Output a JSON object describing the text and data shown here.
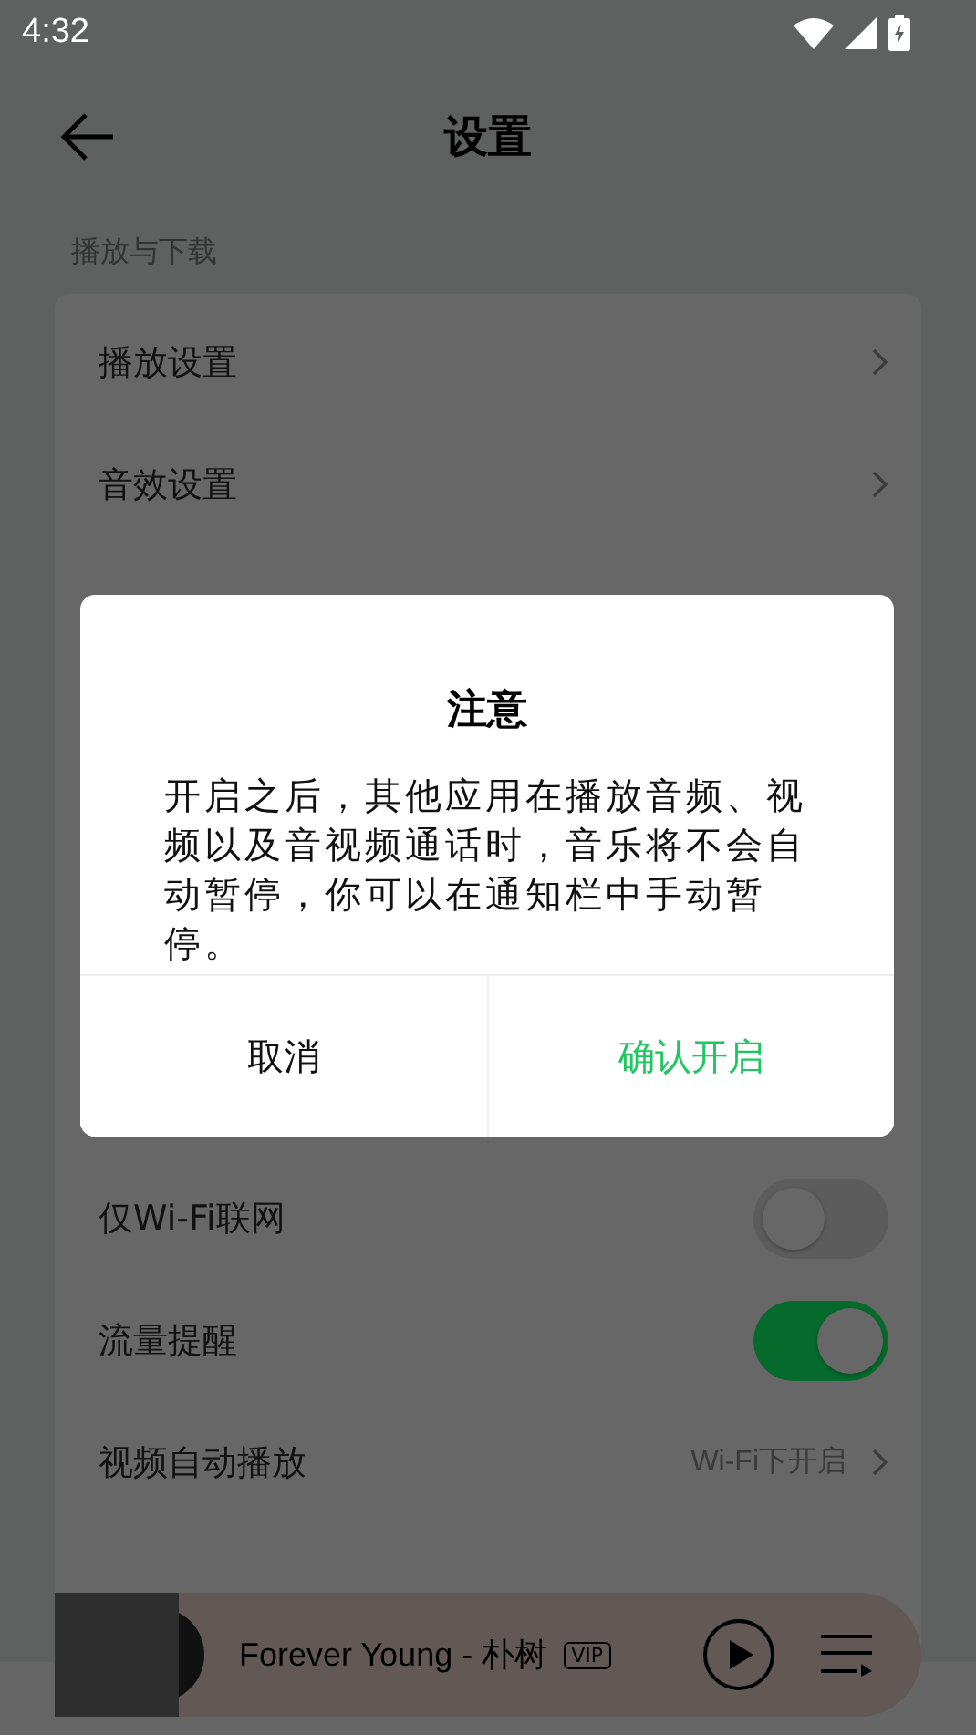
{
  "status_bar": {
    "time": "4:32"
  },
  "header": {
    "title": "设置"
  },
  "section": {
    "title": "播放与下载"
  },
  "rows": [
    {
      "kind": "link",
      "label": "播放设置"
    },
    {
      "kind": "link",
      "label": "音效设置"
    },
    {
      "kind": "hidden"
    },
    {
      "kind": "hidden"
    },
    {
      "kind": "hidden"
    },
    {
      "kind": "hidden"
    },
    {
      "kind": "hidden"
    },
    {
      "kind": "toggle",
      "label": "仅Wi-Fi联网",
      "on": false
    },
    {
      "kind": "toggle",
      "label": "流量提醒",
      "on": true
    },
    {
      "kind": "link",
      "label": "视频自动播放",
      "value": "Wi-Fi下开启"
    }
  ],
  "dialog": {
    "title": "注意",
    "message": "开启之后，其他应用在播放音频、视频以及音视频通话时，音乐将不会自动暂停，你可以在通知栏中手动暂停。",
    "buttons": [
      {
        "label": "取消",
        "kind": "cancel"
      },
      {
        "label": "确认开启",
        "kind": "confirm"
      }
    ]
  },
  "mini_player": {
    "title": "Forever Young - 朴树",
    "badge": "VIP"
  }
}
